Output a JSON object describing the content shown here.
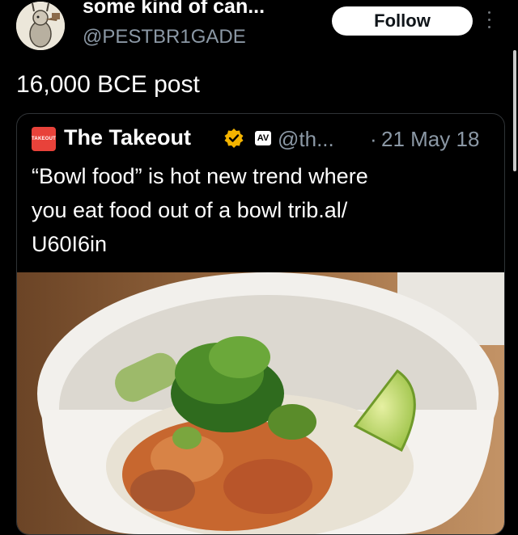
{
  "author": {
    "display_name": "some kind of can...",
    "handle": "@PESTBR1GADE",
    "avatar_icon": "bird-illustration-avatar"
  },
  "follow_label": "Follow",
  "more_icon": "vertical-ellipsis-icon",
  "post_text": "16,000 BCE post",
  "quote": {
    "logo_text": "TAKEOUT",
    "name": "The Takeout",
    "verified_icon": "gold-verified-badge-icon",
    "badge_text": "AV",
    "handle": "@th...",
    "separator": "·",
    "date": "21 May 18",
    "text_lines": [
      "“Bowl food” is hot new trend where",
      "you eat food out of a bowl trib.al/",
      "U60I6in"
    ],
    "image_description": "poke bowl with salmon, seaweed salad and lime in a white bowl"
  },
  "colors": {
    "background": "#000000",
    "secondary_text": "#8b98a5",
    "follow_bg": "#ffffff",
    "takeout_red": "#e8423a",
    "verified_gold": "#f4b400"
  }
}
